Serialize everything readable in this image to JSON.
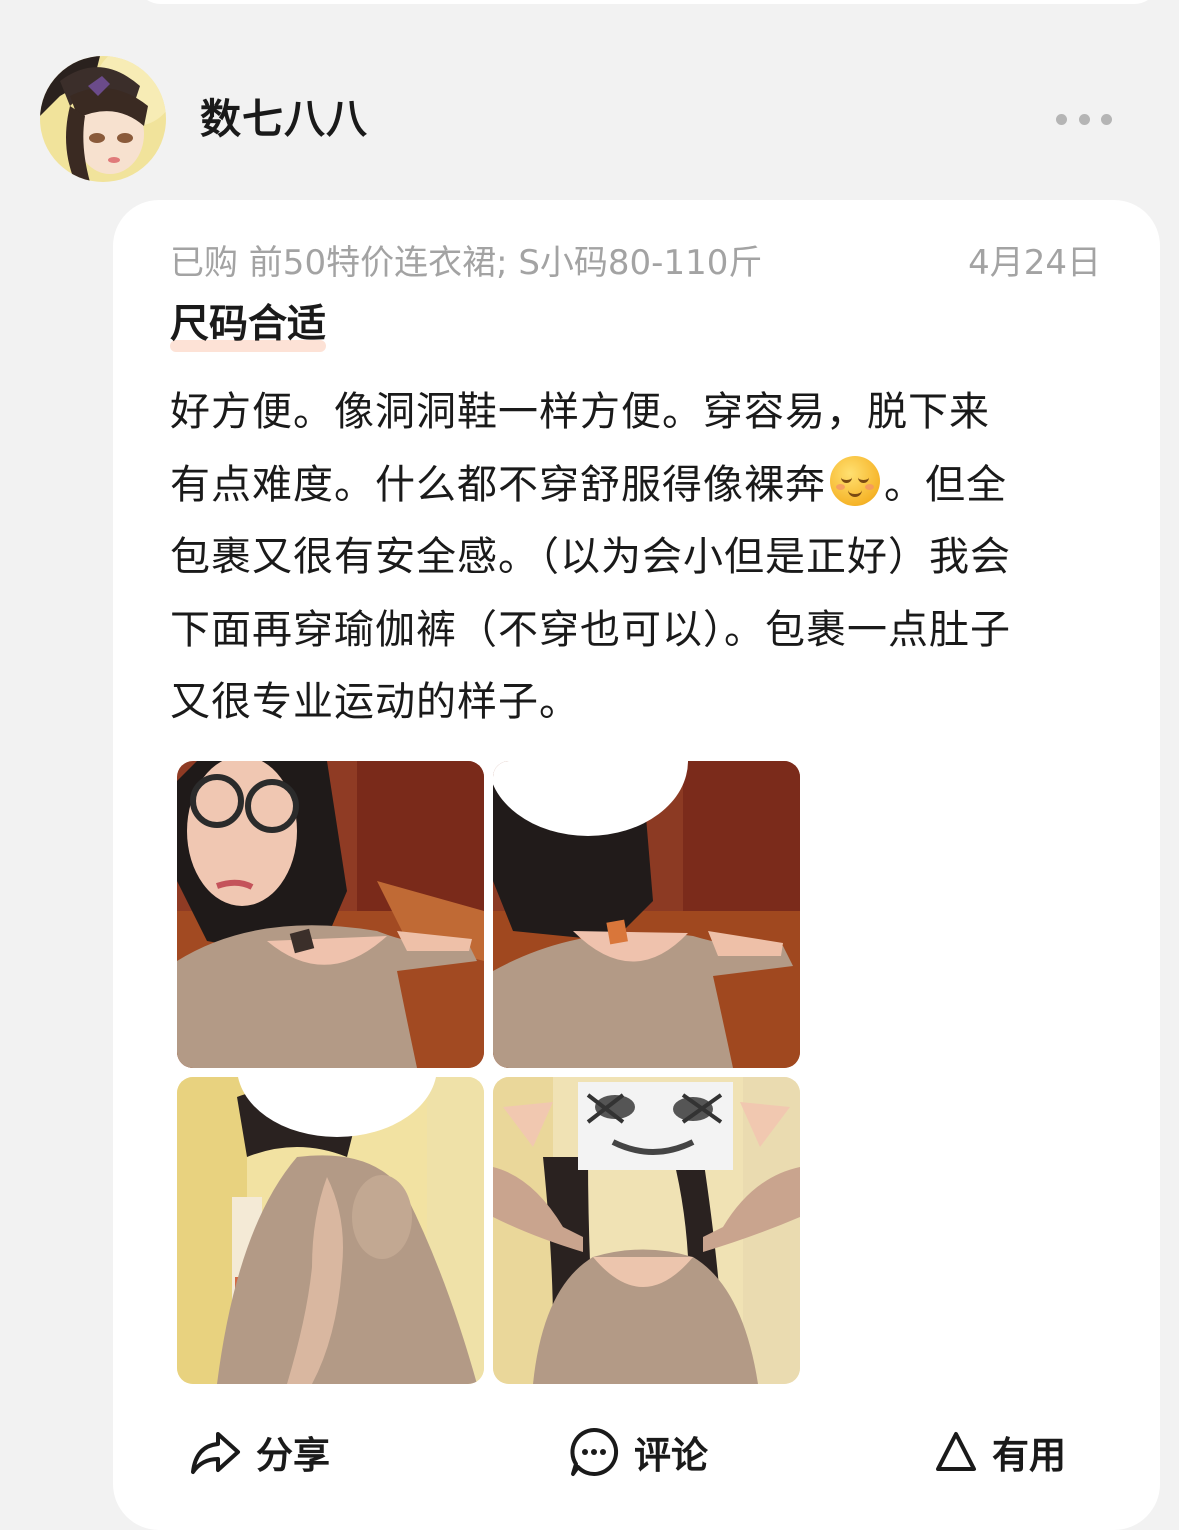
{
  "user": {
    "name": "数七八八",
    "avatar_icon": "avatar-illustration-girl"
  },
  "review": {
    "purchase_info": "已购 前50特价连衣裙; S小码80-110斤",
    "date": "4月24日",
    "tag": "尺码合适",
    "lines": [
      "好方便。像洞洞鞋一样方便。穿容易，脱下来",
      "有点难度。什么都不穿舒服得像裸奔",
      "。但全",
      "包裹又很有安全感。（以为会小但是正好）我会",
      "下面再穿瑜伽裤（不穿也可以）。包裹一点肚子",
      "又很专业运动的样子。"
    ],
    "emoji_icon": "relieved-face-emoji",
    "photos": [
      {
        "name": "review-photo-1"
      },
      {
        "name": "review-photo-2"
      },
      {
        "name": "review-photo-3"
      },
      {
        "name": "review-photo-4"
      }
    ]
  },
  "actions": {
    "share": "分享",
    "comment": "评论",
    "useful": "有用"
  },
  "colors": {
    "page_bg": "#f2f2f2",
    "card_bg": "#ffffff",
    "meta_text": "#a3a3a3",
    "tag_highlight": "#fde2d6",
    "dress_beige": "#b79a82"
  }
}
